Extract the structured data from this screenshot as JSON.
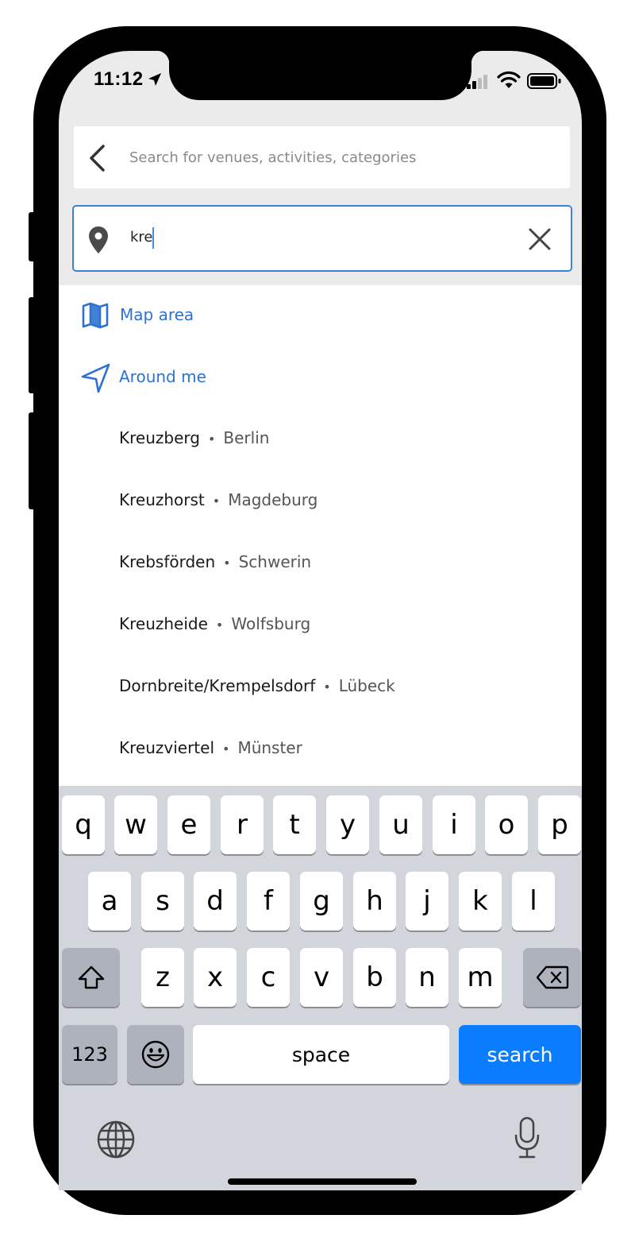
{
  "status_bar": {
    "time": "11:12"
  },
  "search": {
    "placeholder": "Search for venues, activities, categories"
  },
  "location_input": {
    "value": "kre"
  },
  "options": {
    "map_area": "Map area",
    "around_me": "Around me"
  },
  "suggestions": [
    {
      "name": "Kreuzberg",
      "city": "Berlin"
    },
    {
      "name": "Kreuzhorst",
      "city": "Magdeburg"
    },
    {
      "name": "Krebsförden",
      "city": "Schwerin"
    },
    {
      "name": "Kreuzheide",
      "city": "Wolfsburg"
    },
    {
      "name": "Dornbreite/Krempelsdorf",
      "city": "Lübeck"
    },
    {
      "name": "Kreuzviertel",
      "city": "Münster"
    }
  ],
  "separator": "•",
  "keyboard": {
    "row1": [
      "q",
      "w",
      "e",
      "r",
      "t",
      "y",
      "u",
      "i",
      "o",
      "p"
    ],
    "row2": [
      "a",
      "s",
      "d",
      "f",
      "g",
      "h",
      "j",
      "k",
      "l"
    ],
    "row3": [
      "z",
      "x",
      "c",
      "v",
      "b",
      "n",
      "m"
    ],
    "numbers": "123",
    "space": "space",
    "search": "search"
  },
  "colors": {
    "accent": "#2d72d2",
    "focus_border": "#3f82d6",
    "search_key": "#0a7cff"
  }
}
